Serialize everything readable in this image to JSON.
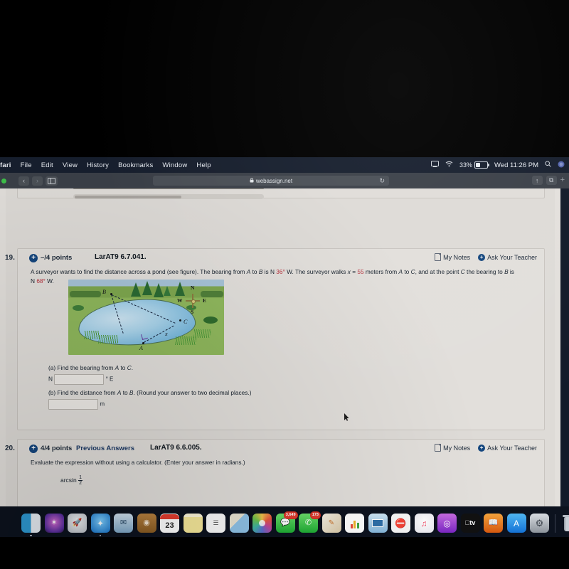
{
  "menu_bar": {
    "apple": "",
    "items": [
      {
        "label": "Safari",
        "bold": true
      },
      {
        "label": "File"
      },
      {
        "label": "Edit"
      },
      {
        "label": "View"
      },
      {
        "label": "History"
      },
      {
        "label": "Bookmarks"
      },
      {
        "label": "Window"
      },
      {
        "label": "Help"
      }
    ],
    "status": {
      "screen_mirror_icon": "screen-mirroring-icon",
      "wifi_icon": "wifi-icon",
      "battery_percent": "33%",
      "clock": "Wed 11:26 PM",
      "search_icon": "search-icon",
      "control_center_icon": "control-center-icon"
    }
  },
  "browser": {
    "back_label": "‹",
    "forward_label": "›",
    "sidebar_label": "sidebar-toggle",
    "url": "webassign.net",
    "lock": "🔒",
    "reload_label": "↻",
    "share_label": "↑",
    "tabs_label": "⧉",
    "new_tab_label": "+"
  },
  "questions": [
    {
      "number": "19.",
      "points": "–/4 points",
      "previous_answers": "",
      "key": "LarAT9 6.7.041.",
      "my_notes": "My Notes",
      "ask_teacher": "Ask Your Teacher",
      "prompt_part1": "A surveyor wants to find the distance across a pond (see figure). The bearing from ",
      "prompt_A": "A",
      "prompt_part2": " to ",
      "prompt_B": "B",
      "prompt_part3": " is N ",
      "angle1": "36°",
      "prompt_part4": " W. The surveyor walks ",
      "prompt_x": "x",
      "prompt_part5": " = ",
      "xvalue": "55",
      "prompt_part6": " meters from ",
      "prompt_A2": "A",
      "prompt_part7": " to ",
      "prompt_C": "C",
      "prompt_part8": ", and at the point ",
      "prompt_C2": "C",
      "prompt_part9": " the bearing to ",
      "prompt_B2": "B",
      "prompt_part10": " is",
      "line2_pre": "N ",
      "angle2": "68°",
      "line2_post": " W.",
      "figure": {
        "point_a": "A",
        "point_b": "B",
        "point_c": "C",
        "x_label": "x",
        "compass": {
          "n": "N",
          "e": "E",
          "s": "S",
          "w": "W"
        }
      },
      "parts": [
        {
          "label": "(a) Find the bearing from ",
          "var1": "A",
          "mid": " to ",
          "var2": "C",
          "tail": ".",
          "prefix": "N",
          "value": "",
          "suffix": "° E"
        },
        {
          "label": "(b) Find the distance from ",
          "var1": "A",
          "mid": " to ",
          "var2": "B",
          "tail": ". (Round your answer to two decimal places.)",
          "prefix": "",
          "value": "",
          "suffix": "m"
        }
      ]
    },
    {
      "number": "20.",
      "points": "4/4 points",
      "previous_answers": "Previous Answers",
      "key": "LarAT9 6.6.005.",
      "my_notes": "My Notes",
      "ask_teacher": "Ask Your Teacher",
      "prompt": "Evaluate the expression without using a calculator. (Enter your answer in radians.)",
      "expression_fn": "arcsin",
      "expression_num": "1",
      "expression_den": "2"
    }
  ],
  "dock": {
    "items": [
      {
        "name": "finder",
        "glyph": "◑",
        "bg": "#2e9ad4",
        "badge": "",
        "running": true
      },
      {
        "name": "siri",
        "glyph": "✴",
        "bg": "#2b1b3d",
        "badge": "",
        "running": false
      },
      {
        "name": "launchpad",
        "glyph": "🚀",
        "bg": "#c9cdd3",
        "badge": "",
        "running": false
      },
      {
        "name": "safari",
        "glyph": "✦",
        "bg": "#1f9bf0",
        "badge": "",
        "running": true
      },
      {
        "name": "mail",
        "glyph": "✉",
        "bg": "#d8dde4",
        "badge": "",
        "running": false
      },
      {
        "name": "contacts",
        "glyph": "◉",
        "bg": "#a06b32",
        "badge": "",
        "running": false
      },
      {
        "name": "calendar",
        "glyph": "23",
        "bg": "#ffffff",
        "badge": "",
        "running": false
      },
      {
        "name": "notes",
        "glyph": "",
        "bg": "#f4e6a8",
        "badge": "",
        "running": false
      },
      {
        "name": "reminders",
        "glyph": "☰",
        "bg": "#f2f2f2",
        "badge": "",
        "running": false
      },
      {
        "name": "maps",
        "glyph": "◢",
        "bg": "#e8e3d2",
        "badge": "",
        "running": false
      },
      {
        "name": "photos",
        "glyph": "✿",
        "bg": "#f5f5f5",
        "badge": "",
        "running": false
      },
      {
        "name": "messages",
        "glyph": "💬",
        "bg": "#2fbf4f",
        "badge": "3,649",
        "running": false
      },
      {
        "name": "facetime",
        "glyph": "📹",
        "bg": "#2fbf4f",
        "badge": "173",
        "running": false
      },
      {
        "name": "pages",
        "glyph": "✎",
        "bg": "#f0a13a",
        "badge": "",
        "running": false
      },
      {
        "name": "numbers",
        "glyph": "█",
        "bg": "#ffffff",
        "badge": "",
        "running": false
      },
      {
        "name": "keynote",
        "glyph": "▭",
        "bg": "#3da5e0",
        "badge": "",
        "running": false
      },
      {
        "name": "news",
        "glyph": "N",
        "bg": "#f2f2f2",
        "badge": "",
        "running": false
      },
      {
        "name": "music",
        "glyph": "♫",
        "bg": "#f4f4f4",
        "badge": "",
        "running": false
      },
      {
        "name": "podcasts",
        "glyph": "◎",
        "bg": "#9b3fd4",
        "badge": "",
        "running": false
      },
      {
        "name": "appletv",
        "glyph": "⁠tv",
        "bg": "#111111",
        "badge": "",
        "running": false
      },
      {
        "name": "books",
        "glyph": "📖",
        "bg": "#e06b17",
        "badge": "",
        "running": false
      },
      {
        "name": "appstore",
        "glyph": "A",
        "bg": "#1f8fe8",
        "badge": "",
        "running": false
      },
      {
        "name": "system-preferences",
        "glyph": "⚙",
        "bg": "#9aa0a8",
        "badge": "",
        "running": false
      }
    ],
    "trash_label": "Trash"
  },
  "colors": {
    "accent_navy": "#14467e",
    "value_red": "#b5303b",
    "page_bg": "#e2dfdb",
    "badge_red": "#e03b2f"
  }
}
